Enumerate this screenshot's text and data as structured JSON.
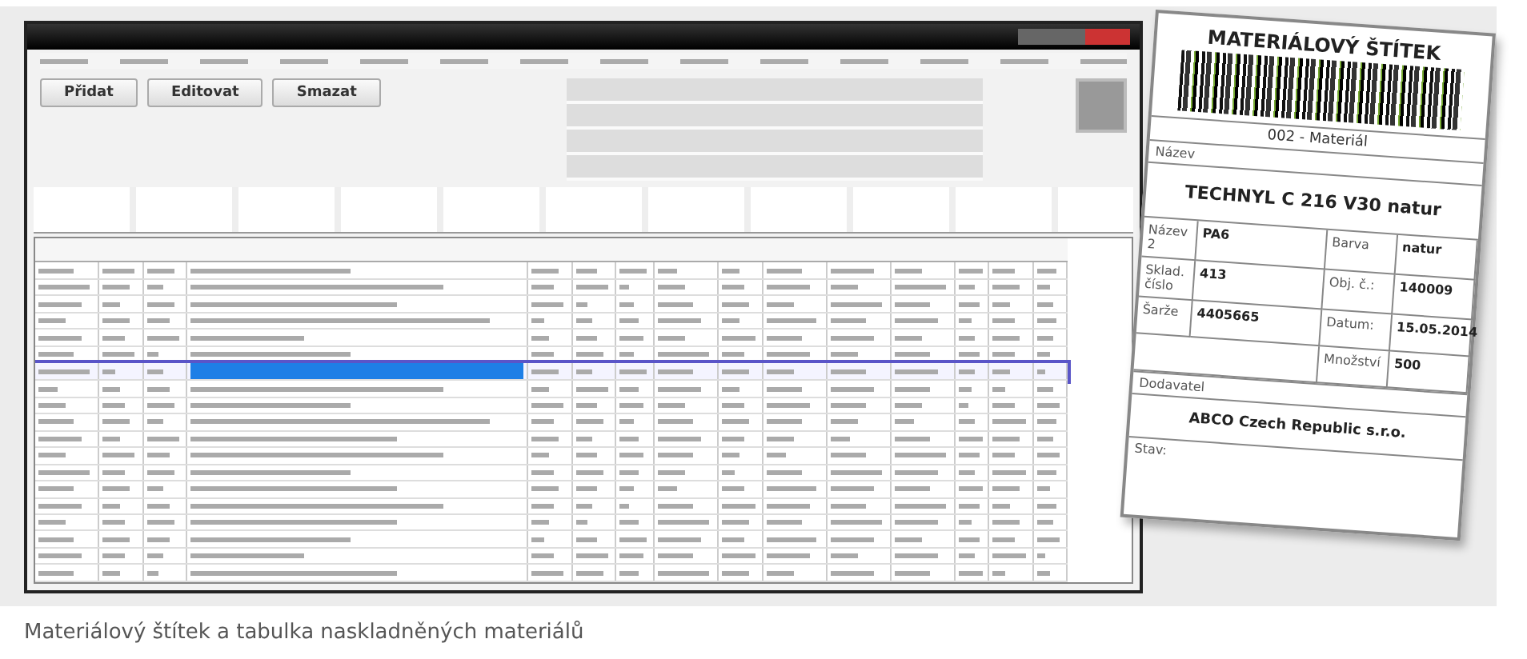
{
  "toolbar": {
    "buttons": [
      {
        "label": "Přidat"
      },
      {
        "label": "Editovat"
      },
      {
        "label": "Smazat"
      }
    ]
  },
  "table": {
    "rows": [
      {
        "selected": false
      },
      {
        "selected": false
      },
      {
        "selected": false
      },
      {
        "selected": false
      },
      {
        "selected": false
      },
      {
        "selected": false
      },
      {
        "selected": true
      },
      {
        "selected": false
      },
      {
        "selected": false
      },
      {
        "selected": false
      },
      {
        "selected": false
      },
      {
        "selected": false
      },
      {
        "selected": false
      },
      {
        "selected": false
      },
      {
        "selected": false
      },
      {
        "selected": false
      },
      {
        "selected": false
      },
      {
        "selected": false
      },
      {
        "selected": false
      }
    ]
  },
  "label": {
    "title": "MATERIÁLOVÝ ŠTÍTEK",
    "subtitle": "002 - Materiál",
    "name_label": "Název",
    "name": "TECHNYL C 216 V30 natur",
    "fields": [
      {
        "left_label": "Název 2",
        "left_value": "PA6",
        "right_label": "Barva",
        "right_value": "natur"
      },
      {
        "left_label": "Sklad. číslo",
        "left_value": "413",
        "right_label": "Obj. č.:",
        "right_value": "140009"
      },
      {
        "left_label": "Šarže",
        "left_value": "4405665",
        "right_label": "Datum:",
        "right_value": "15.05.2014"
      },
      {
        "right_label": "Množství",
        "right_value": "500"
      }
    ],
    "supplier_label": "Dodavatel",
    "supplier": "ABCO Czech Republic s.r.o.",
    "note_label": "Stav:"
  },
  "caption": "Materiálový štítek a tabulka naskladněných materiálů"
}
